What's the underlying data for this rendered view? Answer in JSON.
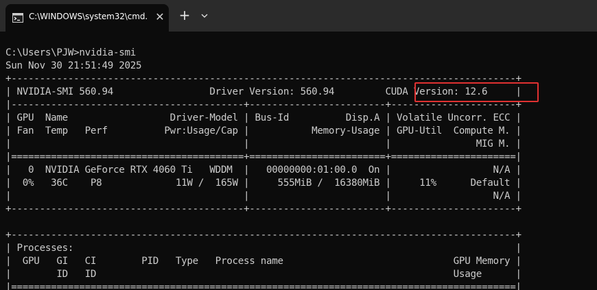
{
  "window": {
    "tab_title": "C:\\WINDOWS\\system32\\cmd.",
    "close_glyph": "✕",
    "new_tab_glyph": "+",
    "tab_icon": "cmd-icon",
    "dropdown_icon": "chevron-down-icon"
  },
  "terminal": {
    "lines": [
      "",
      "C:\\Users\\PJW>nvidia-smi",
      "Sun Nov 30 21:51:49 2025",
      "+-----------------------------------------------------------------------------------------+",
      "| NVIDIA-SMI 560.94                 Driver Version: 560.94         CUDA Version: 12.6     |",
      "|-----------------------------------------+------------------------+----------------------+",
      "| GPU  Name                  Driver-Model | Bus-Id          Disp.A | Volatile Uncorr. ECC |",
      "| Fan  Temp   Perf          Pwr:Usage/Cap |           Memory-Usage | GPU-Util  Compute M. |",
      "|                                         |                        |               MIG M. |",
      "|=========================================+========================+======================|",
      "|   0  NVIDIA GeForce RTX 4060 Ti   WDDM  |   00000000:01:00.0  On |                  N/A |",
      "|  0%   36C    P8             11W /  165W |     555MiB /  16380MiB |     11%      Default |",
      "|                                         |                        |                  N/A |",
      "+-----------------------------------------+------------------------+----------------------+",
      "",
      "+-----------------------------------------------------------------------------------------+",
      "| Processes:                                                                              |",
      "|  GPU   GI   CI        PID   Type   Process name                              GPU Memory |",
      "|        ID   ID                                                               Usage      |",
      "|=========================================================================================|"
    ]
  },
  "annotation": {
    "label": "CUDA Version highlight",
    "color": "#e03131"
  },
  "colors": {
    "titlebar_bg": "#2b2b2b",
    "terminal_bg": "#0c0c0c",
    "terminal_fg": "#cccccc"
  }
}
